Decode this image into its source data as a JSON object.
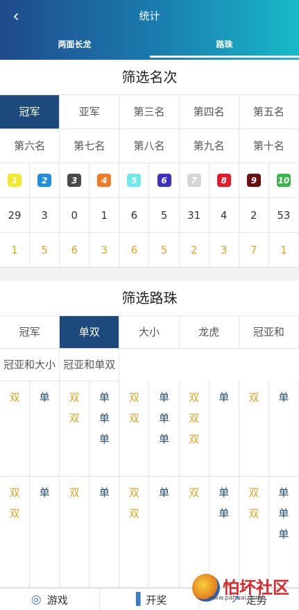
{
  "header": {
    "title": "统计",
    "back_icon": "chevron-left-icon",
    "tabs": [
      {
        "label": "两面长龙",
        "active": false
      },
      {
        "label": "路珠",
        "active": true
      }
    ]
  },
  "rank_filter": {
    "title": "筛选名次",
    "items": [
      "冠军",
      "亚军",
      "第三名",
      "第四名",
      "第五名",
      "第六名",
      "第七名",
      "第八名",
      "第九名",
      "第十名"
    ],
    "active_index": 0
  },
  "balls": [
    {
      "num": "1",
      "color": "#f4e92a"
    },
    {
      "num": "2",
      "color": "#1e8fe0"
    },
    {
      "num": "3",
      "color": "#4a4a4a"
    },
    {
      "num": "4",
      "color": "#f07a25"
    },
    {
      "num": "5",
      "color": "#6ee8e8"
    },
    {
      "num": "6",
      "color": "#3b2fc4"
    },
    {
      "num": "7",
      "color": "#d6d6d6"
    },
    {
      "num": "8",
      "color": "#e11b2a"
    },
    {
      "num": "9",
      "color": "#6a0e0e"
    },
    {
      "num": "10",
      "color": "#39b54a"
    }
  ],
  "counts": [
    "29",
    "3",
    "0",
    "1",
    "6",
    "5",
    "31",
    "4",
    "2",
    "53"
  ],
  "missing": [
    "1",
    "5",
    "6",
    "3",
    "6",
    "5",
    "2",
    "3",
    "7",
    "1"
  ],
  "road_filter": {
    "title": "筛选路珠",
    "items": [
      "冠军",
      "单双",
      "大小",
      "龙虎",
      "冠亚和",
      "冠亚和大小",
      "冠亚和单双"
    ],
    "active_index": 1
  },
  "road_rows": [
    [
      [
        "双"
      ],
      [
        "单"
      ],
      [
        "双",
        "双"
      ],
      [
        "单",
        "单",
        "单"
      ],
      [
        "双",
        "双"
      ],
      [
        "单",
        "单",
        "单"
      ],
      [
        "双",
        "双",
        "双"
      ],
      [
        "单"
      ],
      [
        "双"
      ],
      [
        "单"
      ]
    ],
    [
      [
        "双",
        "双"
      ],
      [
        "单"
      ],
      [
        "双"
      ],
      [
        "单"
      ],
      [
        "双",
        "双"
      ],
      [
        "单"
      ],
      [
        "双"
      ],
      [
        "单",
        "单"
      ],
      [
        "双",
        "双"
      ],
      [
        "单",
        "单",
        "单"
      ]
    ]
  ],
  "bottom_nav": [
    {
      "label": "游戏",
      "icon": "lifebuoy-icon"
    },
    {
      "label": "开奖",
      "icon": "bar-chart-icon"
    },
    {
      "label": "走势",
      "icon": "trend-icon"
    }
  ],
  "watermark": {
    "text": "怕坏社区",
    "url": "www.pahuai.com"
  }
}
